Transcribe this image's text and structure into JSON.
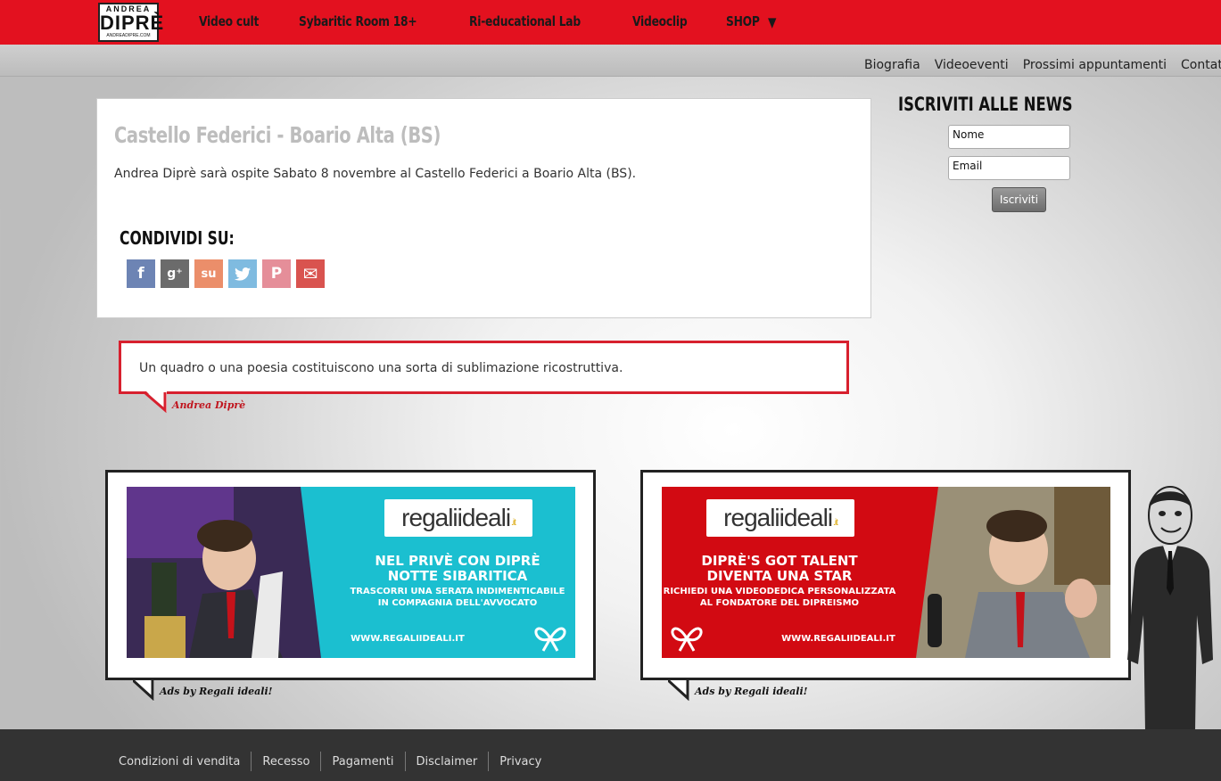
{
  "logo": {
    "line1": "ANDREA",
    "line2": "DIPRÈ",
    "line3": "ANDREADIPRE.COM"
  },
  "main_nav": [
    {
      "label": "Video cult"
    },
    {
      "label": "Sybaritic Room 18+"
    },
    {
      "label": "Ri-educational Lab"
    },
    {
      "label": "Videoclip"
    },
    {
      "label": "SHOP"
    }
  ],
  "sub_nav": [
    {
      "label": "Biografia"
    },
    {
      "label": "Videoeventi"
    },
    {
      "label": "Prossimi appuntamenti"
    },
    {
      "label": "Contat"
    }
  ],
  "article": {
    "title": "Castello Federici - Boario Alta (BS)",
    "text": "Andrea Diprè sarà ospite Sabato 8 novembre al Castello Federici a Boario Alta (BS)."
  },
  "share": {
    "title": "CONDIVIDI SU:",
    "icons": [
      {
        "name": "facebook-icon",
        "glyph": "f",
        "color": "#6d84b4"
      },
      {
        "name": "google-plus-icon",
        "glyph": "g⁺",
        "color": "#6b6b6b"
      },
      {
        "name": "stumbleupon-icon",
        "glyph": "su",
        "color": "#eb8e6a"
      },
      {
        "name": "twitter-icon",
        "glyph": "🐦",
        "color": "#7fbbe0"
      },
      {
        "name": "pinterest-icon",
        "glyph": "P",
        "color": "#e58e99"
      },
      {
        "name": "email-icon",
        "glyph": "✉",
        "color": "#d9534f"
      }
    ]
  },
  "quote": {
    "text": "Un quadro o una poesia costituiscono una sorta di sublimazione ricostruttiva.",
    "author": "Andrea Diprè"
  },
  "newsletter": {
    "title": "ISCRIVITI ALLE NEWS",
    "name_value": "Nome",
    "email_value": "Email",
    "button": "Iscriviti"
  },
  "ads": [
    {
      "brand": "regaliideali",
      "brand_suffix": ".it",
      "headline1": "NEL PRIVÈ CON DIPRÈ",
      "headline2": "NOTTE SIBARITICA",
      "sub1": "TRASCORRI UNA SERATA INDIMENTICABILE",
      "sub2": "IN COMPAGNIA DELL'AVVOCATO",
      "url": "WWW.REGALIIDEALI.IT",
      "label": "Ads by Regali ideali!",
      "bg": "#1bbfd0"
    },
    {
      "brand": "regaliideali",
      "brand_suffix": ".it",
      "headline1": "DIPRÈ'S GOT TALENT",
      "headline2": "DIVENTA UNA STAR",
      "sub1": "RICHIEDI UNA VIDEODEDICA PERSONALIZZATA",
      "sub2": "AL FONDATORE DEL DIPREISMO",
      "url": "WWW.REGALIIDEALI.IT",
      "label": "Ads by Regali ideali!",
      "bg": "#d20a12"
    }
  ],
  "footer": [
    {
      "label": "Condizioni di vendita"
    },
    {
      "label": "Recesso"
    },
    {
      "label": "Pagamenti"
    },
    {
      "label": "Disclaimer"
    },
    {
      "label": "Privacy"
    }
  ],
  "colors": {
    "brand_red": "#e3111f",
    "footer": "#333333",
    "quote_border": "#d7202e"
  }
}
